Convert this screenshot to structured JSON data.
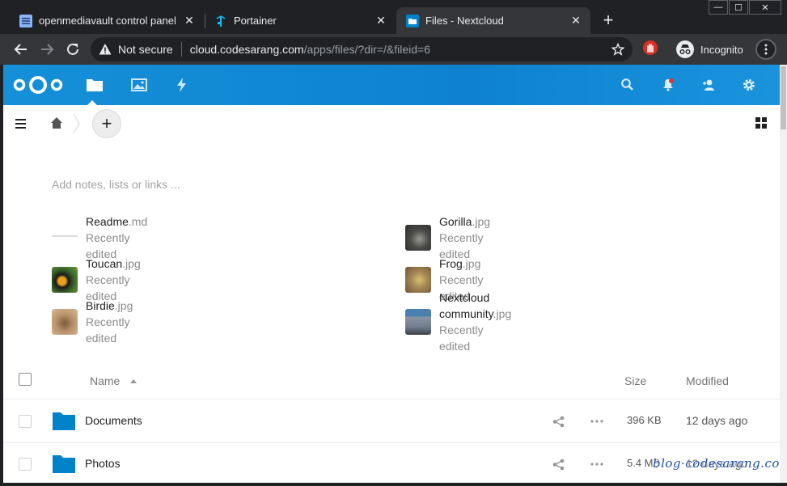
{
  "browser": {
    "tabs": [
      {
        "title": "openmediavault control panel - c",
        "active": false,
        "favicon": "omv-list-icon"
      },
      {
        "title": "Portainer",
        "active": false,
        "favicon": "portainer-crane-icon"
      },
      {
        "title": "Files - Nextcloud",
        "active": true,
        "favicon": "folder-icon"
      }
    ],
    "close_glyph": "✕",
    "new_tab_glyph": "+",
    "security_label": "Not secure",
    "url_host": "cloud.codesarang.com",
    "url_path": "/apps/files/?dir=/&fileid=6",
    "incognito_label": "Incognito",
    "window_controls": [
      "—",
      "☐",
      "✕"
    ]
  },
  "nextcloud": {
    "header_color": "#0e82cf",
    "add_glyph": "+",
    "notes_placeholder": "Add notes, lists or links ...",
    "recent_files": [
      {
        "base": "Readme",
        "ext": ".md",
        "status": "Recently edited",
        "thumb": "#f0f0f0"
      },
      {
        "base": "Gorilla",
        "ext": ".jpg",
        "status": "Recently edited",
        "thumb": "#4a4a48"
      },
      {
        "base": "Toucan",
        "ext": ".jpg",
        "status": "Recently edited",
        "thumb": "#3d6b2a"
      },
      {
        "base": "Frog",
        "ext": ".jpg",
        "status": "Recently edited",
        "thumb": "#a88a55"
      },
      {
        "base": "Birdie",
        "ext": ".jpg",
        "status": "Recently edited",
        "thumb": "#b8926a"
      },
      {
        "base": "Nextcloud community",
        "ext": ".jpg",
        "status": "Recently edited",
        "thumb": "#6f7d8c"
      }
    ],
    "columns": {
      "name": "Name",
      "size": "Size",
      "modified": "Modified"
    },
    "files": [
      {
        "name": "Documents",
        "size": "396 KB",
        "modified": "12 days ago"
      },
      {
        "name": "Photos",
        "size": "5.4 MB",
        "modified": "12 days ago"
      }
    ],
    "watermark": "blog·codesarang.com"
  }
}
